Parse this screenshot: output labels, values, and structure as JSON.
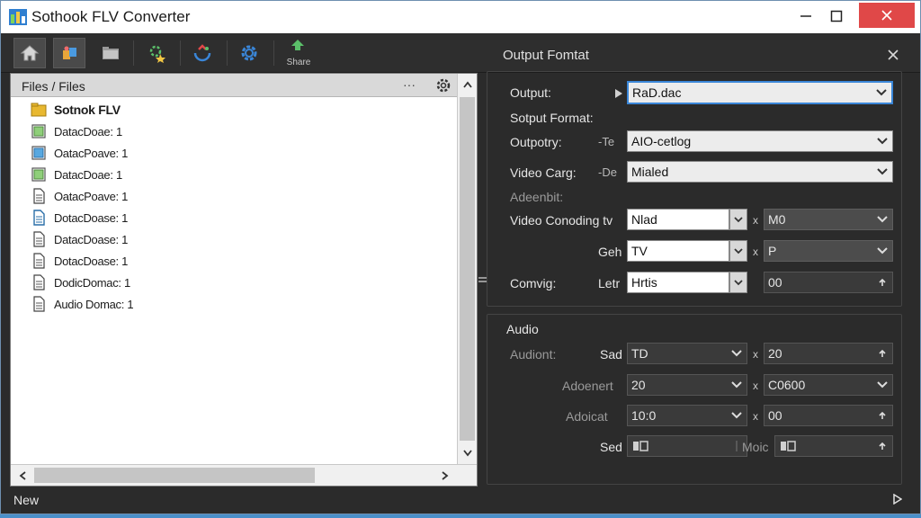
{
  "window": {
    "title": "Sothook FLV Converter",
    "accent_close": "#e04848"
  },
  "toolbar": {
    "buttons": [
      {
        "name": "home-icon"
      },
      {
        "name": "add-files-icon"
      },
      {
        "name": "folder-icon"
      },
      {
        "name": "effects-icon"
      },
      {
        "name": "convert-icon"
      },
      {
        "name": "settings-gear-icon"
      },
      {
        "name": "share-icon",
        "label": "Share"
      }
    ]
  },
  "file_panel": {
    "header": "Files / Files",
    "more": "···",
    "items": [
      {
        "label": "Sotnok FLV",
        "icon": "folder-yellow-icon",
        "bold": true
      },
      {
        "label": "DatacDoae: 1",
        "icon": "video-file-icon"
      },
      {
        "label": "OatacPoave: 1",
        "icon": "video-file-blue-icon"
      },
      {
        "label": "DatacDoae: 1",
        "icon": "video-file-icon"
      },
      {
        "label": "OatacPoave: 1",
        "icon": "document-icon"
      },
      {
        "label": "DotacDoase: 1",
        "icon": "document-blue-icon"
      },
      {
        "label": "DatacDoase: 1",
        "icon": "document-icon"
      },
      {
        "label": "DotacDoase: 1",
        "icon": "document-icon"
      },
      {
        "label": "DodicDomac: 1",
        "icon": "document-icon"
      },
      {
        "label": "Audio Domac: 1",
        "icon": "document-icon"
      }
    ]
  },
  "settings": {
    "title": "Output Fomtat",
    "output_label": "Output:",
    "output_value": "RaD.dac",
    "sotput_format_label": "Sotput Format:",
    "outpotry_label": "Outpotry:",
    "outpotry_prefix": "-Te",
    "outpotry_value": "AIO-cetlog",
    "video_carg_label": "Video Carg:",
    "video_carg_prefix": "-De",
    "video_carg_value": "Mialed",
    "adeenbit_label": "Adeenbit:",
    "video_conoding_label": "Video Conoding tv",
    "video_conoding_value": "Nlad",
    "video_conoding_value2": "M0",
    "geh_label": "Geh",
    "geh_value": "TV",
    "geh_value2": "P",
    "comvig_label": "Comvig:",
    "letr_label": "Letr",
    "letr_value": "Hrtis",
    "letr_value2": "00",
    "x_sep": "x",
    "audio_title": "Audio",
    "audiont_label": "Audiont:",
    "sad_label": "Sad",
    "sad_value": "TD",
    "sad_value2": "20",
    "adoenert_label": "Adoenert",
    "adoenert_value": "20",
    "adoenert_value2": "C0600",
    "adoicat_label": "Adoicat",
    "adoicat_value": "10:0",
    "adoicat_value2": "00",
    "sed_label": "Sed",
    "moic_label": "Moic"
  },
  "statusbar": {
    "text": "New"
  }
}
